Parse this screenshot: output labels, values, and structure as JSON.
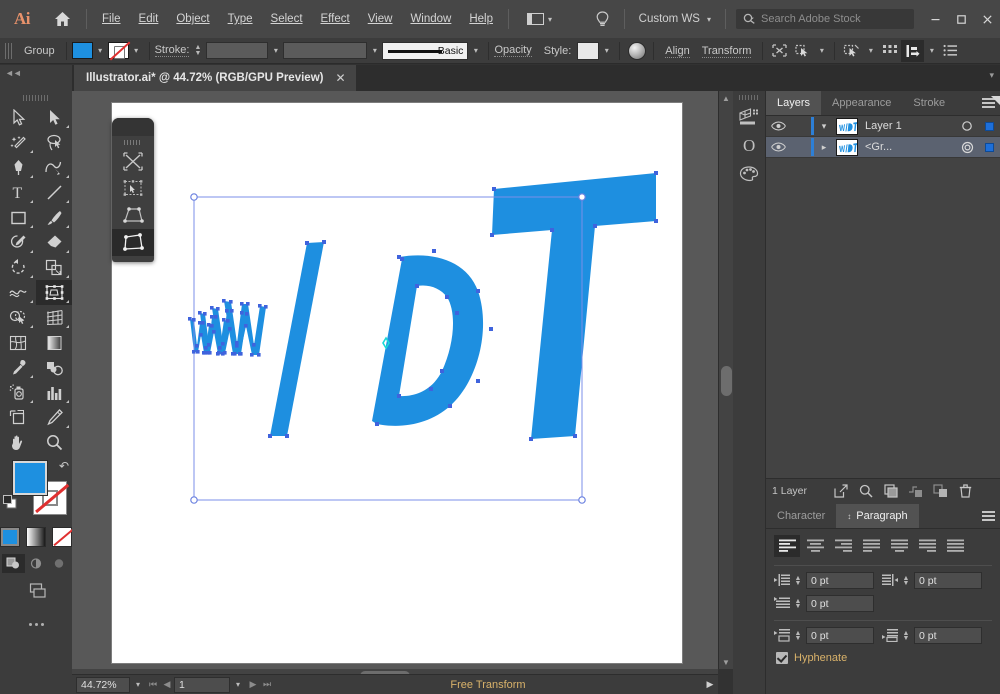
{
  "app": {
    "name": "Adobe Illustrator",
    "logo_text": "Ai"
  },
  "menubar": {
    "items": [
      {
        "label": "File",
        "mnemonic": "F"
      },
      {
        "label": "Edit",
        "mnemonic": "E"
      },
      {
        "label": "Object",
        "mnemonic": "O"
      },
      {
        "label": "Type",
        "mnemonic": "T"
      },
      {
        "label": "Select",
        "mnemonic": "S"
      },
      {
        "label": "Effect",
        "mnemonic": "c"
      },
      {
        "label": "View",
        "mnemonic": "V"
      },
      {
        "label": "Window",
        "mnemonic": "W"
      },
      {
        "label": "Help",
        "mnemonic": "H"
      }
    ],
    "workspace": "Custom WS",
    "search_placeholder": "Search Adobe Stock",
    "window_controls": {
      "minimize": "—",
      "maximize": "□",
      "close": "✕"
    }
  },
  "controlbar": {
    "selection_label": "Group",
    "fill_color": "#1e90e0",
    "stroke_label": "Stroke:",
    "stroke_weight": "",
    "stroke_profile": "",
    "brush_label": "Basic",
    "opacity_label": "Opacity",
    "style_label": "Style:",
    "align_label": "Align",
    "transform_label": "Transform"
  },
  "document": {
    "tab_title": "Illustrator.ai* @ 44.72% (RGB/GPU Preview)",
    "close_glyph": "✕"
  },
  "toolbar": {
    "tools": [
      "selection-tool",
      "direct-selection-tool",
      "magic-wand-tool",
      "lasso-tool",
      "pen-tool",
      "curvature-tool",
      "type-tool",
      "line-segment-tool",
      "rectangle-tool",
      "paintbrush-tool",
      "shaper-tool",
      "eraser-tool",
      "rotate-tool",
      "scale-tool",
      "width-tool",
      "free-transform-tool",
      "shape-builder-tool",
      "perspective-grid-tool",
      "mesh-tool",
      "gradient-tool",
      "eyedropper-tool",
      "blend-tool",
      "symbol-sprayer-tool",
      "column-graph-tool",
      "artboard-tool",
      "slice-tool",
      "hand-tool",
      "zoom-tool"
    ],
    "selected_tool": "free-transform-tool",
    "fill_color": "#1e90e0",
    "stroke_color": "#ffffff",
    "stroke_is_none": true,
    "modes": [
      "color-mode",
      "gradient-mode",
      "none-mode"
    ],
    "selected_mode": "color-mode",
    "draw_modes": [
      "draw-normal",
      "draw-behind",
      "draw-inside"
    ],
    "selected_draw_mode": "draw-normal"
  },
  "free_transform_widget": {
    "tools": [
      "constrain",
      "free-transform",
      "perspective-distort",
      "free-distort"
    ],
    "selected": "free-distort"
  },
  "layers_panel": {
    "tabs": [
      {
        "label": "Layers",
        "active": true
      },
      {
        "label": "Appearance",
        "active": false
      },
      {
        "label": "Stroke",
        "active": false
      }
    ],
    "rows": [
      {
        "name": "Layer 1",
        "visible": true,
        "expanded": true,
        "selected": false,
        "disclosure": "chevron-down",
        "target": "circle-open",
        "color": "#1e6fd9",
        "indent": 0
      },
      {
        "name": "<Gr...",
        "visible": true,
        "expanded": false,
        "selected": true,
        "disclosure": "chevron-right",
        "target": "circle-double",
        "color": "#1e6fd9",
        "indent": 1
      }
    ],
    "footer": {
      "count_label": "1 Layer",
      "buttons": [
        "release-to-layers-icon",
        "locate-object-icon",
        "make-clipping-mask-icon",
        "create-sublayer-icon",
        "create-new-layer-icon",
        "delete-selection-icon"
      ]
    }
  },
  "type_panel": {
    "tabs": [
      {
        "label": "Character",
        "active": false
      },
      {
        "label": "Paragraph",
        "active": true
      }
    ],
    "align_buttons": [
      "align-left",
      "align-center",
      "align-right",
      "justify-last-left",
      "justify-last-center",
      "justify-last-right",
      "justify-all"
    ],
    "selected_align": "align-left",
    "fields": [
      {
        "icon": "indent-left-icon",
        "value": "0 pt",
        "name": "left-indent"
      },
      {
        "icon": "indent-right-icon",
        "value": "0 pt",
        "name": "right-indent"
      },
      {
        "icon": "first-line-indent-icon",
        "value": "0 pt",
        "name": "first-line-indent"
      },
      {
        "icon": "space-before-icon",
        "value": "0 pt",
        "name": "space-before"
      },
      {
        "icon": "space-after-icon",
        "value": "0 pt",
        "name": "space-after"
      }
    ],
    "hyphenate": {
      "label": "Hyphenate",
      "checked": true
    }
  },
  "statusbar": {
    "zoom": "44.72%",
    "page": "1",
    "status_text": "Free Transform"
  },
  "artwork": {
    "description": "Perspective-distorted vector text reading W W / D T",
    "fill_color": "#1e8fe0",
    "selection_color": "#4a6fe0",
    "anchor_color": "#3a5fd9",
    "center_marker_color": "#18d8d8",
    "letters": [
      "W",
      "W",
      "/",
      "D",
      "T"
    ]
  },
  "icon_strip": {
    "items": [
      "3d-materials-icon",
      "libraries-icon",
      "swatches-icon"
    ]
  }
}
